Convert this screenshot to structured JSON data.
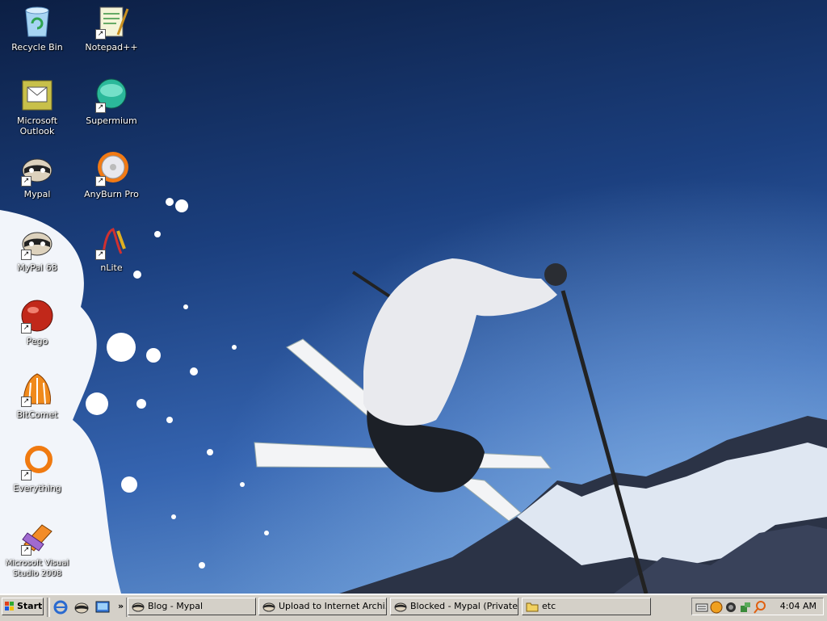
{
  "desktop": {
    "icons": [
      {
        "label": "Recycle Bin",
        "icon": "recycle-bin-icon"
      },
      {
        "label": "Notepad++",
        "icon": "notepad-plus-icon"
      },
      {
        "label": "Microsoft Outlook",
        "icon": "outlook-icon"
      },
      {
        "label": "Supermium",
        "icon": "supermium-icon"
      },
      {
        "label": "Mypal",
        "icon": "mypal-icon"
      },
      {
        "label": "AnyBurn Pro",
        "icon": "anyburn-icon"
      },
      {
        "label": "MyPal 68",
        "icon": "mypal-icon"
      },
      {
        "label": "nLite",
        "icon": "nlite-icon"
      },
      {
        "label": "Pego",
        "icon": "pego-icon"
      },
      {
        "label": "BitComet",
        "icon": "bitcomet-icon"
      },
      {
        "label": "Everything",
        "icon": "everything-icon"
      },
      {
        "label": "Microsoft Visual Studio 2008",
        "icon": "visual-studio-icon"
      }
    ]
  },
  "taskbar": {
    "start_label": "Start",
    "quick_launch_overflow": "»",
    "buttons": [
      {
        "label": "Blog - Mypal"
      },
      {
        "label": "Upload to Internet Archi..."
      },
      {
        "label": "Blocked - Mypal (Private ..."
      },
      {
        "label": "etc"
      }
    ],
    "clock": "4:04 AM"
  },
  "colors": {
    "taskbar": "#d4d0c8",
    "sky": "#1b3f7e"
  }
}
